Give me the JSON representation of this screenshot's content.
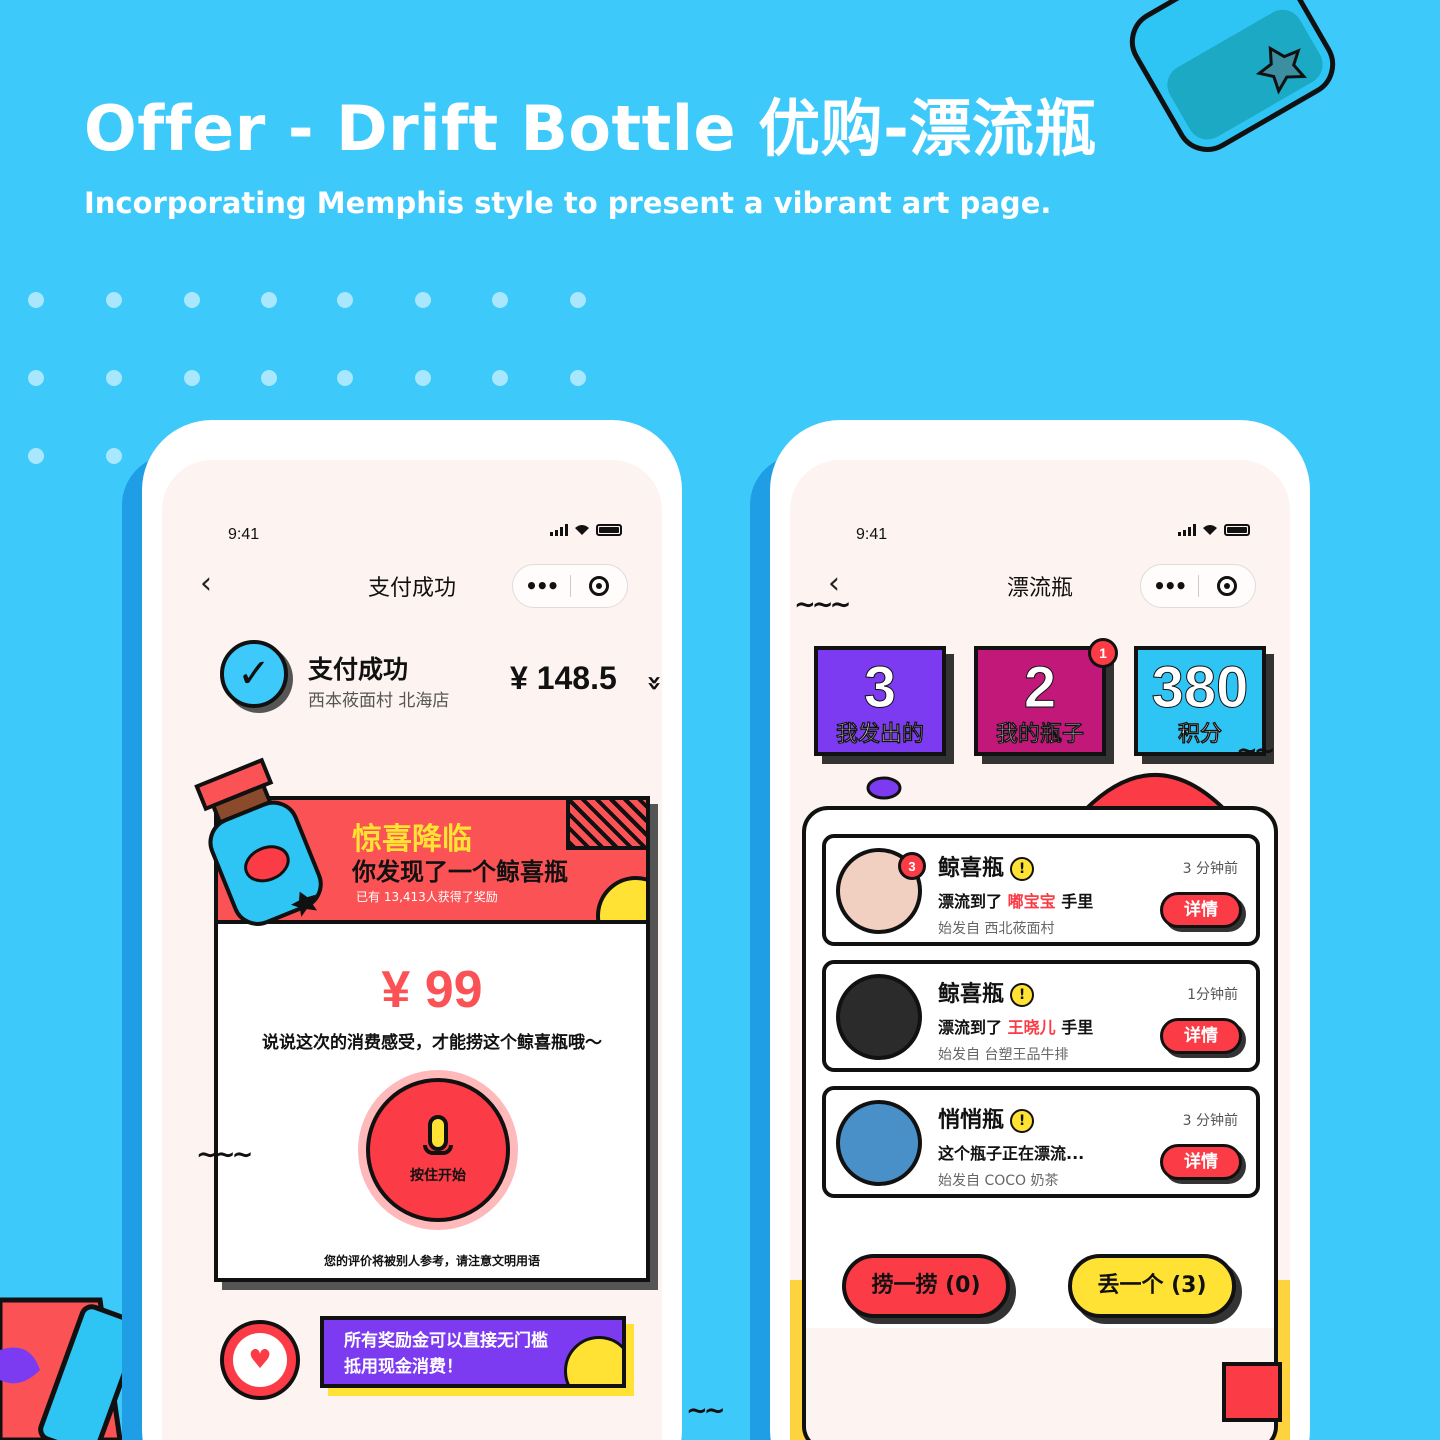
{
  "page": {
    "headline": "Offer - Drift Bottle  优购-漂流瓶",
    "subline": "Incorporating Memphis style to present a vibrant art page."
  },
  "colors": {
    "background": "#3ec9fb",
    "accent_red": "#fb3b45",
    "accent_yellow": "#ffe233",
    "accent_purple": "#7c3bf1",
    "accent_magenta": "#c2187a",
    "accent_blue": "#2ec4f4"
  },
  "payment_screen": {
    "status_time": "9:41",
    "nav_title": "支付成功",
    "back_icon": "chevron-left-icon",
    "summary": {
      "title": "支付成功",
      "store": "西本莜面村 北海店",
      "amount": "¥ 148.5"
    },
    "surprise_card": {
      "title": "惊喜降临",
      "subtitle": "你发现了一个鲸喜瓶",
      "note": "已有 13,413人获得了奖励",
      "reward": "¥ 99",
      "prompt": "说说这次的消费感受，才能捞这个鲸喜瓶哦～",
      "mic_label": "按住开始",
      "review_note": "您的评价将被别人参考，请注意文明用语"
    },
    "promo": {
      "line1": "所有奖励金可以直接无门槛",
      "line2": "抵用现金消费！"
    }
  },
  "bottle_screen": {
    "status_time": "9:41",
    "nav_title": "漂流瓶",
    "stats": [
      {
        "value": "3",
        "label": "我发出的"
      },
      {
        "value": "2",
        "label": "我的瓶子",
        "badge": "1"
      },
      {
        "value": "380",
        "label": "积分"
      }
    ],
    "bottles": [
      {
        "title": "鲸喜瓶",
        "time": "3 分钟前",
        "line_prefix": "漂流到了",
        "name": "嘟宝宝",
        "line_suffix": "手里",
        "origin": "始发自 西北莜面村",
        "badge": "3",
        "button": "详情"
      },
      {
        "title": "鲸喜瓶",
        "time": "1分钟前",
        "line_prefix": "漂流到了",
        "name": "王晓儿",
        "line_suffix": "手里",
        "origin": "始发自 台塑王品牛排",
        "button": "详情"
      },
      {
        "title": "悄悄瓶",
        "time": "3 分钟前",
        "line_prefix": "这个瓶子正在漂流...",
        "origin": "始发自 COCO 奶茶",
        "button": "详情"
      }
    ],
    "actions": {
      "catch": "捞一捞 (0)",
      "throw": "丢一个 (3)"
    }
  }
}
